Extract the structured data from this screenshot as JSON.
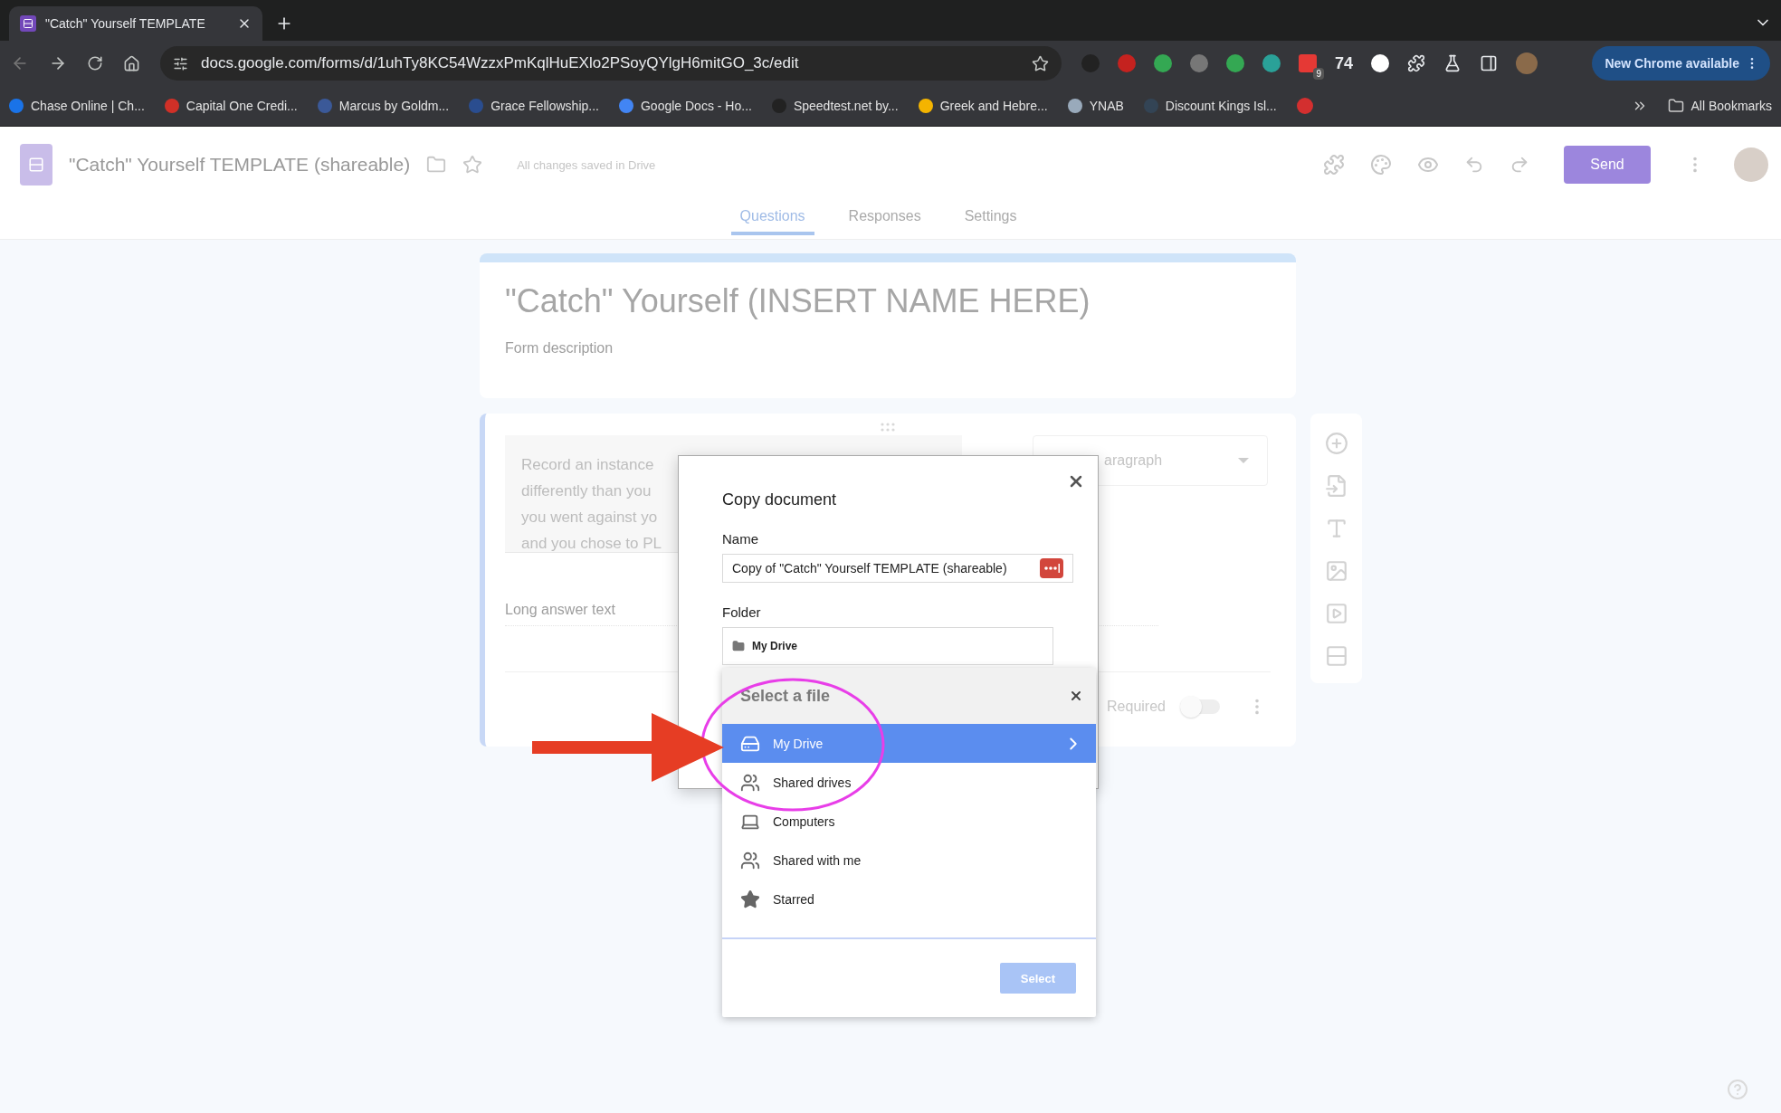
{
  "browser": {
    "tabs": [
      {
        "title": "\"Catch\" Yourself TEMPLATE",
        "selected": true
      }
    ],
    "address": "docs.google.com/forms/d/1uhTy8KC54WzzxPmKqlHuEXlo2PSoyQYlgH6mitGO_3c/edit",
    "extension_text": "74",
    "extension_badge": "9",
    "update_button": "New Chrome available",
    "bookmarks": [
      {
        "label": "Chase Online | Ch..."
      },
      {
        "label": "Capital One Credi..."
      },
      {
        "label": "Marcus by Goldm..."
      },
      {
        "label": "Grace Fellowship..."
      },
      {
        "label": "Google Docs - Ho..."
      },
      {
        "label": "Speedtest.net by..."
      },
      {
        "label": "Greek and Hebre..."
      },
      {
        "label": "YNAB"
      },
      {
        "label": "Discount Kings Isl..."
      }
    ],
    "all_bookmarks": "All Bookmarks"
  },
  "form_header": {
    "title": "\"Catch\" Yourself TEMPLATE (shareable)",
    "status": "All changes saved in Drive",
    "send_button": "Send",
    "tabs": [
      {
        "label": "Questions",
        "selected": true
      },
      {
        "label": "Responses",
        "selected": false
      },
      {
        "label": "Settings",
        "selected": false
      }
    ]
  },
  "form": {
    "title": "\"Catch\" Yourself (INSERT NAME HERE)",
    "description": {
      "placeholder": "Form description"
    },
    "question": {
      "text_lines": [
        "Record an instance",
        "differently than you",
        "you went against yo",
        "and you chose to PL"
      ],
      "type": "aragraph",
      "answer_hint": "Long answer text",
      "required_label": "Required",
      "required": false
    }
  },
  "copy_dialog": {
    "title": "Copy document",
    "name_label": "Name",
    "name_value": "Copy of \"Catch\" Yourself TEMPLATE (shareable)",
    "folder_label": "Folder",
    "folder_value": "My Drive"
  },
  "file_picker": {
    "title": "Select a file",
    "items": [
      {
        "label": "My Drive",
        "kind": "drive",
        "selected": true
      },
      {
        "label": "Shared drives",
        "kind": "team",
        "selected": false
      },
      {
        "label": "Computers",
        "kind": "computers",
        "selected": false
      },
      {
        "label": "Shared with me",
        "kind": "people",
        "selected": false
      },
      {
        "label": "Starred",
        "kind": "star",
        "selected": false
      }
    ],
    "select_button": "Select"
  }
}
